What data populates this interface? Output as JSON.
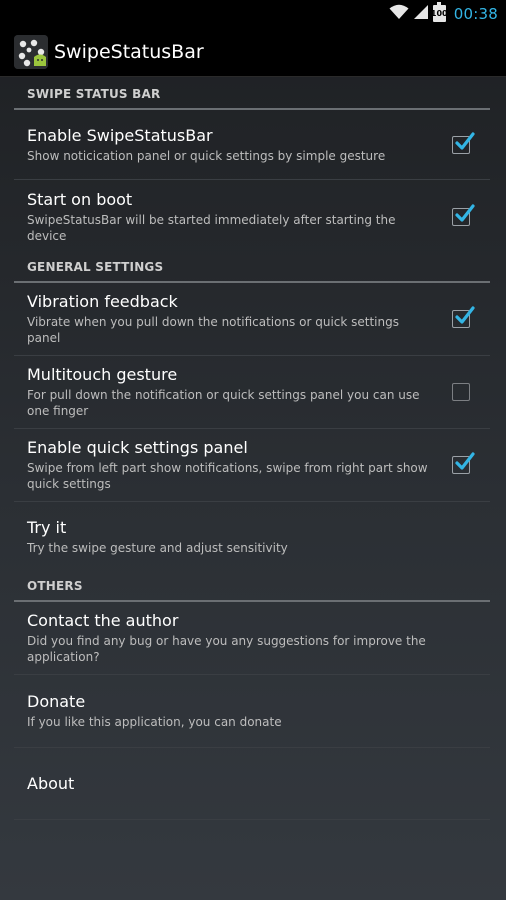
{
  "status_bar": {
    "battery": "100",
    "time": "00:38",
    "time_color": "#33b5e5"
  },
  "action_bar": {
    "title": "SwipeStatusBar",
    "icon": "app-launcher-icon"
  },
  "accent_color": "#33b5e5",
  "sections": [
    {
      "header": "SWIPE STATUS BAR",
      "items": [
        {
          "title": "Enable SwipeStatusBar",
          "summary": "Show noticication panel or quick settings by simple gesture",
          "checked": true
        },
        {
          "title": "Start on boot",
          "summary": "SwipeStatusBar will be started immediately after starting the device",
          "checked": true
        }
      ]
    },
    {
      "header": "GENERAL SETTINGS",
      "items": [
        {
          "title": "Vibration feedback",
          "summary": "Vibrate when you pull down the notifications or quick settings panel",
          "checked": true
        },
        {
          "title": "Multitouch gesture",
          "summary": "For pull down the notification or quick settings panel you can use one finger",
          "checked": false
        },
        {
          "title": "Enable quick settings panel",
          "summary": "Swipe from left part show notifications, swipe from right part show quick settings",
          "checked": true
        },
        {
          "title": "Try it",
          "summary": "Try the swipe gesture and adjust sensitivity"
        }
      ]
    },
    {
      "header": "OTHERS",
      "items": [
        {
          "title": "Contact the author",
          "summary": "Did you find any bug or have you any suggestions for improve the application?"
        },
        {
          "title": "Donate",
          "summary": "If you like this application, you can donate"
        },
        {
          "title": "About",
          "summary": ""
        }
      ]
    }
  ]
}
